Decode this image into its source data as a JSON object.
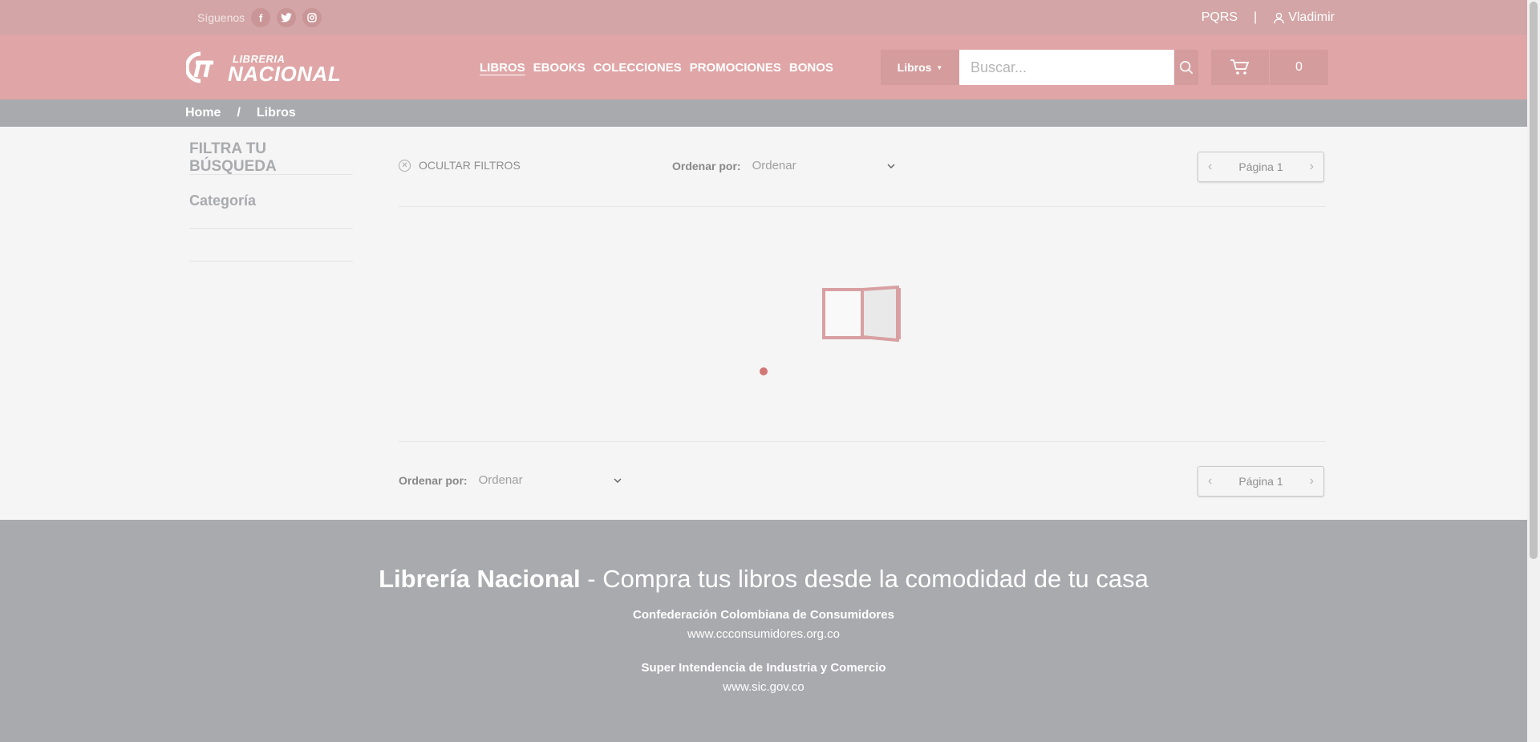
{
  "topbar": {
    "follow_label": "Síguenos",
    "social": [
      "facebook-icon",
      "twitter-icon",
      "instagram-icon"
    ],
    "pqrs": "PQRS",
    "separator": "|",
    "user_name": "Vladimir"
  },
  "header": {
    "logo_top": "LIBRERIA",
    "logo_bottom": "NACIONAL",
    "nav": [
      "LIBROS",
      "EBOOKS",
      "COLECCIONES",
      "PROMOCIONES",
      "BONOS"
    ],
    "active_nav": "LIBROS",
    "search_category": "Libros",
    "search_placeholder": "Buscar...",
    "cart_count": "0"
  },
  "breadcrumb": {
    "home": "Home",
    "sep": "/",
    "current": "Libros"
  },
  "sidebar": {
    "title": "FILTRA TU BÚSQUEDA",
    "category": "Categoría"
  },
  "main": {
    "hide_filters": "OCULTAR FILTROS",
    "sort_label": "Ordenar por:",
    "sort_value": "Ordenar",
    "page_label": "Página 1"
  },
  "footer": {
    "brand": "Librería Nacional",
    "tagline": " - Compra tus libros desde la comodidad de tu casa",
    "org1": "Confederación Colombiana de Consumidores",
    "url1": "www.ccconsumidores.org.co",
    "org2": "Super Intendencia de Industria y Comercio",
    "url2": "www.sic.gov.co"
  },
  "colors": {
    "topbar": "#d3a5a6",
    "header": "#e0a6a7",
    "breadcrumb": "#a9aaae",
    "footer": "#a9aaae",
    "loader_dot": "#d37776"
  }
}
